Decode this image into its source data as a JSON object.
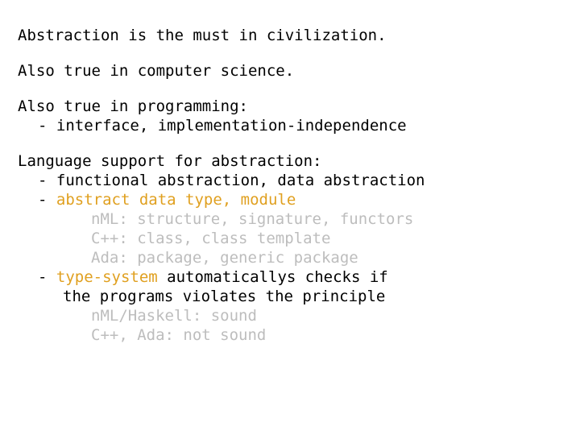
{
  "slide": {
    "background_color": "#ffffff",
    "text_color": "#000000",
    "accent_color": "#e0a020",
    "muted_color": "#bdbdbd",
    "blocks": [
      {
        "id": "intro",
        "lines": [
          {
            "id": "l1",
            "text": "Abstraction is the must in civilization."
          }
        ]
      },
      {
        "id": "cs",
        "lines": [
          {
            "id": "l2",
            "text": "Also true in computer science."
          }
        ]
      },
      {
        "id": "programming",
        "lines": [
          {
            "id": "l3",
            "text": "Also true in programming:"
          },
          {
            "id": "l4_dash",
            "text": "-"
          },
          {
            "id": "l4",
            "text": "interface, implementation-independence"
          }
        ]
      },
      {
        "id": "language-support",
        "lines": [
          {
            "id": "l5",
            "text": "Language support for abstraction:"
          },
          {
            "id": "l6_dash",
            "text": "-"
          },
          {
            "id": "l6",
            "text": "functional abstraction, data abstraction"
          },
          {
            "id": "l7_dash",
            "text": "-"
          },
          {
            "id": "l7",
            "text": "abstract data type, module"
          },
          {
            "id": "l8",
            "text": "nML: structure, signature, functors"
          },
          {
            "id": "l9",
            "text": "C++: class, class template"
          },
          {
            "id": "l10",
            "text": "Ada: package, generic package"
          },
          {
            "id": "l11_dash",
            "text": "-"
          },
          {
            "id": "l11_accent",
            "text": "type-system"
          },
          {
            "id": "l11_rest",
            "text": " automaticallys checks if"
          },
          {
            "id": "l12",
            "text": "the programs violates the principle"
          },
          {
            "id": "l13",
            "text": "nML/Haskell: sound"
          },
          {
            "id": "l14",
            "text": "C++, Ada: not sound"
          }
        ]
      }
    ]
  }
}
